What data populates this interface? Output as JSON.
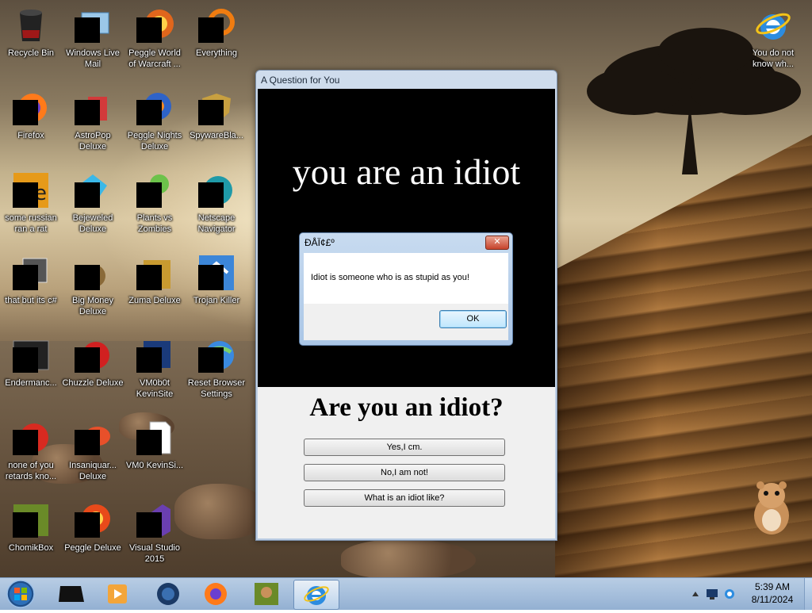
{
  "desktop": {
    "icons": [
      {
        "label": "Recycle Bin",
        "icon": "recycle-bin-icon"
      },
      {
        "label": "Windows Live Mail",
        "icon": "mail-icon"
      },
      {
        "label": "Peggle World of Warcraft ...",
        "icon": "game-icon"
      },
      {
        "label": "Everything",
        "icon": "search-icon"
      },
      {
        "label": "You do not know wh...",
        "icon": "internet-explorer-icon"
      },
      {
        "label": "Firefox",
        "icon": "firefox-icon"
      },
      {
        "label": "AstroPop Deluxe",
        "icon": "game-icon"
      },
      {
        "label": "Peggle Nights Deluxe",
        "icon": "game-icon"
      },
      {
        "label": "SpywareBla...",
        "icon": "shield-icon"
      },
      {
        "label": "some russian ran a rat",
        "icon": "app-icon"
      },
      {
        "label": "Bejeweled Deluxe",
        "icon": "gem-icon"
      },
      {
        "label": "Plants vs Zombies",
        "icon": "game-icon"
      },
      {
        "label": "Netscape Navigator",
        "icon": "browser-icon"
      },
      {
        "label": "that but its c#",
        "icon": "app-icon"
      },
      {
        "label": "Big Money Deluxe",
        "icon": "money-bag-icon"
      },
      {
        "label": "Zuma Deluxe",
        "icon": "game-icon"
      },
      {
        "label": "Trojan Killer",
        "icon": "shield-icon"
      },
      {
        "label": "Endermanc...",
        "icon": "app-icon"
      },
      {
        "label": "Chuzzle Deluxe",
        "icon": "game-icon"
      },
      {
        "label": "VM0b0t KevinSite",
        "icon": "app-icon"
      },
      {
        "label": "Reset Browser Settings",
        "icon": "globe-icon"
      },
      {
        "label": "none of you retards kno...",
        "icon": "app-icon"
      },
      {
        "label": "Insaniquar... Deluxe",
        "icon": "game-icon"
      },
      {
        "label": "VM0 KevinSi...",
        "icon": "file-icon"
      },
      {
        "label": "ChomikBox",
        "icon": "app-icon"
      },
      {
        "label": "Peggle Deluxe",
        "icon": "game-icon"
      },
      {
        "label": "Visual Studio 2015",
        "icon": "visual-studio-icon"
      }
    ]
  },
  "window": {
    "title": "A Question for You",
    "banner": "you are an idiot",
    "question": "Are you an idiot?",
    "buttons": [
      "Yes,I cm.",
      "No,I am not!",
      "What is an idiot like?"
    ]
  },
  "dialog": {
    "title": "ÐÅÏ¢£º",
    "message": "Idiot is someone who is as stupid as you!",
    "ok_label": "OK",
    "close_symbol": "✕"
  },
  "taskbar": {
    "items": [
      "start-orb",
      "black-app-icon",
      "media-player-icon",
      "browser-globe-icon",
      "firefox-icon",
      "chomikbox-icon",
      "internet-explorer-icon"
    ],
    "active_item": "internet-explorer-icon",
    "clock_time": "5:39 AM",
    "clock_date": "8/11/2024"
  },
  "colors": {
    "taskbar": "#a6bfdc",
    "window_frame": "#b9cbe2",
    "close_button": "#c7432c",
    "ok_button": "#bee6fd"
  }
}
